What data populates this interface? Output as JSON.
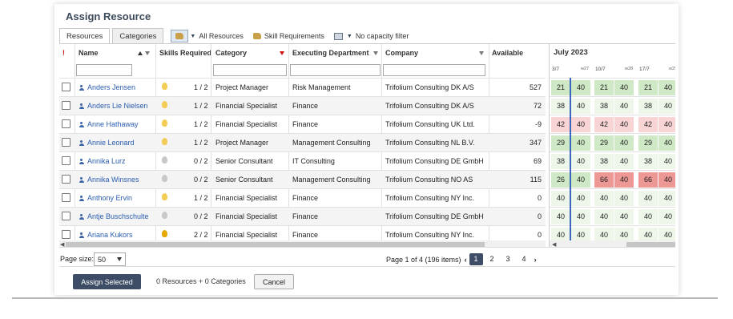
{
  "dialog": {
    "title": "Assign Resource"
  },
  "tabs": [
    {
      "label": "Resources",
      "active": true
    },
    {
      "label": "Categories",
      "active": false
    }
  ],
  "toolbar": {
    "all_resources_label": "All Resources",
    "skill_requirements_label": "Skill Requirements",
    "capacity_filter_label": "No capacity filter"
  },
  "columns": {
    "alert": "!",
    "name": "Name",
    "skills": "Skills Required",
    "category": "Category",
    "department": "Executing Department",
    "company": "Company",
    "available": "Available"
  },
  "rows": [
    {
      "name": "Anders Jensen",
      "skill_state": "on",
      "skills": "1 / 2",
      "category": "Project Manager",
      "department": "Risk Management",
      "company": "Trifolium Consulting DK A/S",
      "available": "527"
    },
    {
      "name": "Anders Lie Nielsen",
      "skill_state": "on",
      "skills": "1 / 2",
      "category": "Financial Specialist",
      "department": "Finance",
      "company": "Trifolium Consulting DK A/S",
      "available": "72"
    },
    {
      "name": "Anne Hathaway",
      "skill_state": "on",
      "skills": "1 / 2",
      "category": "Financial Specialist",
      "department": "Finance",
      "company": "Trifolium Consulting UK Ltd.",
      "available": "-9"
    },
    {
      "name": "Annie Leonard",
      "skill_state": "on",
      "skills": "1 / 2",
      "category": "Project Manager",
      "department": "Management Consulting",
      "company": "Trifolium Consulting NL B.V.",
      "available": "347"
    },
    {
      "name": "Annika Lurz",
      "skill_state": "off",
      "skills": "0 / 2",
      "category": "Senior Consultant",
      "department": "IT Consulting",
      "company": "Trifolium Consulting DE GmbH",
      "available": "69"
    },
    {
      "name": "Annika Winsnes",
      "skill_state": "off",
      "skills": "0 / 2",
      "category": "Senior Consultant",
      "department": "Management Consulting",
      "company": "Trifolium Consulting NO AS",
      "available": "115"
    },
    {
      "name": "Anthony Ervin",
      "skill_state": "on",
      "skills": "1 / 2",
      "category": "Financial Specialist",
      "department": "Finance",
      "company": "Trifolium Consulting NY Inc.",
      "available": "0"
    },
    {
      "name": "Antje Buschschulte",
      "skill_state": "off",
      "skills": "0 / 2",
      "category": "Financial Specialist",
      "department": "Finance",
      "company": "Trifolium Consulting DE GmbH",
      "available": "0"
    },
    {
      "name": "Ariana Kukors",
      "skill_state": "full",
      "skills": "2 / 2",
      "category": "Financial Specialist",
      "department": "Finance",
      "company": "Trifolium Consulting NY Inc.",
      "available": "0"
    }
  ],
  "timeline": {
    "month": "July 2023",
    "weeks": [
      {
        "date": "3/7",
        "week": "w27"
      },
      {
        "date": "10/7",
        "week": "w28"
      },
      {
        "date": "17/7",
        "week": "w29"
      }
    ],
    "rows": [
      [
        {
          "a": "21",
          "b": "40",
          "c": "g"
        },
        {
          "a": "21",
          "b": "40",
          "c": "g"
        },
        {
          "a": "21",
          "b": "40",
          "c": "g"
        }
      ],
      [
        {
          "a": "38",
          "b": "40",
          "c": "w"
        },
        {
          "a": "38",
          "b": "40",
          "c": "w"
        },
        {
          "a": "38",
          "b": "40",
          "c": "w"
        }
      ],
      [
        {
          "a": "42",
          "b": "40",
          "c": "p"
        },
        {
          "a": "42",
          "b": "40",
          "c": "p"
        },
        {
          "a": "42",
          "b": "40",
          "c": "p"
        }
      ],
      [
        {
          "a": "29",
          "b": "40",
          "c": "g"
        },
        {
          "a": "29",
          "b": "40",
          "c": "g"
        },
        {
          "a": "29",
          "b": "40",
          "c": "g"
        }
      ],
      [
        {
          "a": "38",
          "b": "40",
          "c": "w"
        },
        {
          "a": "38",
          "b": "40",
          "c": "w"
        },
        {
          "a": "38",
          "b": "40",
          "c": "w"
        }
      ],
      [
        {
          "a": "26",
          "b": "40",
          "c": "g"
        },
        {
          "a": "66",
          "b": "40",
          "c": "r"
        },
        {
          "a": "66",
          "b": "40",
          "c": "r"
        }
      ],
      [
        {
          "a": "40",
          "b": "40",
          "c": "w"
        },
        {
          "a": "40",
          "b": "40",
          "c": "w"
        },
        {
          "a": "40",
          "b": "40",
          "c": "w"
        }
      ],
      [
        {
          "a": "40",
          "b": "40",
          "c": "w"
        },
        {
          "a": "40",
          "b": "40",
          "c": "w"
        },
        {
          "a": "40",
          "b": "40",
          "c": "w"
        }
      ],
      [
        {
          "a": "40",
          "b": "40",
          "c": "w"
        },
        {
          "a": "40",
          "b": "40",
          "c": "w"
        },
        {
          "a": "40",
          "b": "40",
          "c": "w"
        }
      ]
    ]
  },
  "pager": {
    "page_size_label": "Page size:",
    "page_size": "50",
    "summary": "Page 1 of 4 (196 items)",
    "pages": [
      "1",
      "2",
      "3",
      "4"
    ],
    "current": "1"
  },
  "footer": {
    "assign_label": "Assign Selected",
    "selection_count": "0 Resources + 0 Categories",
    "cancel_label": "Cancel"
  },
  "colors": {
    "primary_button": "#3d4d66",
    "link": "#2a5db0",
    "capacity_ok": "#cfe8c6",
    "capacity_light": "#eef6ea",
    "capacity_over": "#f8d4d4",
    "capacity_high": "#ee9896",
    "today_marker": "#3a66c0"
  }
}
